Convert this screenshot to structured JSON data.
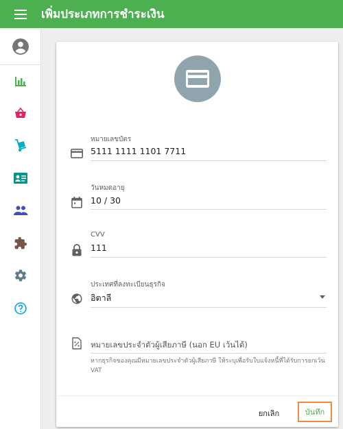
{
  "header": {
    "title": "เพิ่มประเภทการชำระเงิน",
    "menu_icon": "menu-icon",
    "background": "#4caf50"
  },
  "sidebar": {
    "items": [
      {
        "icon": "account-circle-icon",
        "color": "#757575"
      },
      {
        "icon": "bar-chart-icon",
        "color": "#4caf50"
      },
      {
        "icon": "basket-icon",
        "color": "#e91e63"
      },
      {
        "icon": "hand-truck-icon",
        "color": "#00acc1"
      },
      {
        "icon": "contact-card-icon",
        "color": "#009688"
      },
      {
        "icon": "people-icon",
        "color": "#3f51b5"
      },
      {
        "icon": "puzzle-icon",
        "color": "#795548"
      },
      {
        "icon": "gear-icon",
        "color": "#607d8b"
      },
      {
        "icon": "help-circle-icon",
        "color": "#03a9f4"
      }
    ]
  },
  "form": {
    "card_number": {
      "label": "หมายเลขบัตร",
      "value": "5111 1111 1101 7711"
    },
    "expiry": {
      "label": "วันหมดอายุ",
      "value": "10 / 30"
    },
    "cvv": {
      "label": "CVV",
      "value": "111"
    },
    "country": {
      "label": "ประเทศที่ลงทะเบียนธุรกิจ",
      "value": "อิตาลี"
    },
    "vat": {
      "placeholder": "หมายเลขประจำตัวผู้เสียภาษี (นอก EU เว้นได้)",
      "hint": "หากธุรกิจของคุณมีหมายเลขประจำตัวผู้เสียภาษี ให้ระบุเพื่อรับใบแจ้งหนี้ที่ได้รับการยกเว้น VAT"
    }
  },
  "actions": {
    "cancel_label": "ยกเลิก",
    "save_label": "บันทึก"
  }
}
